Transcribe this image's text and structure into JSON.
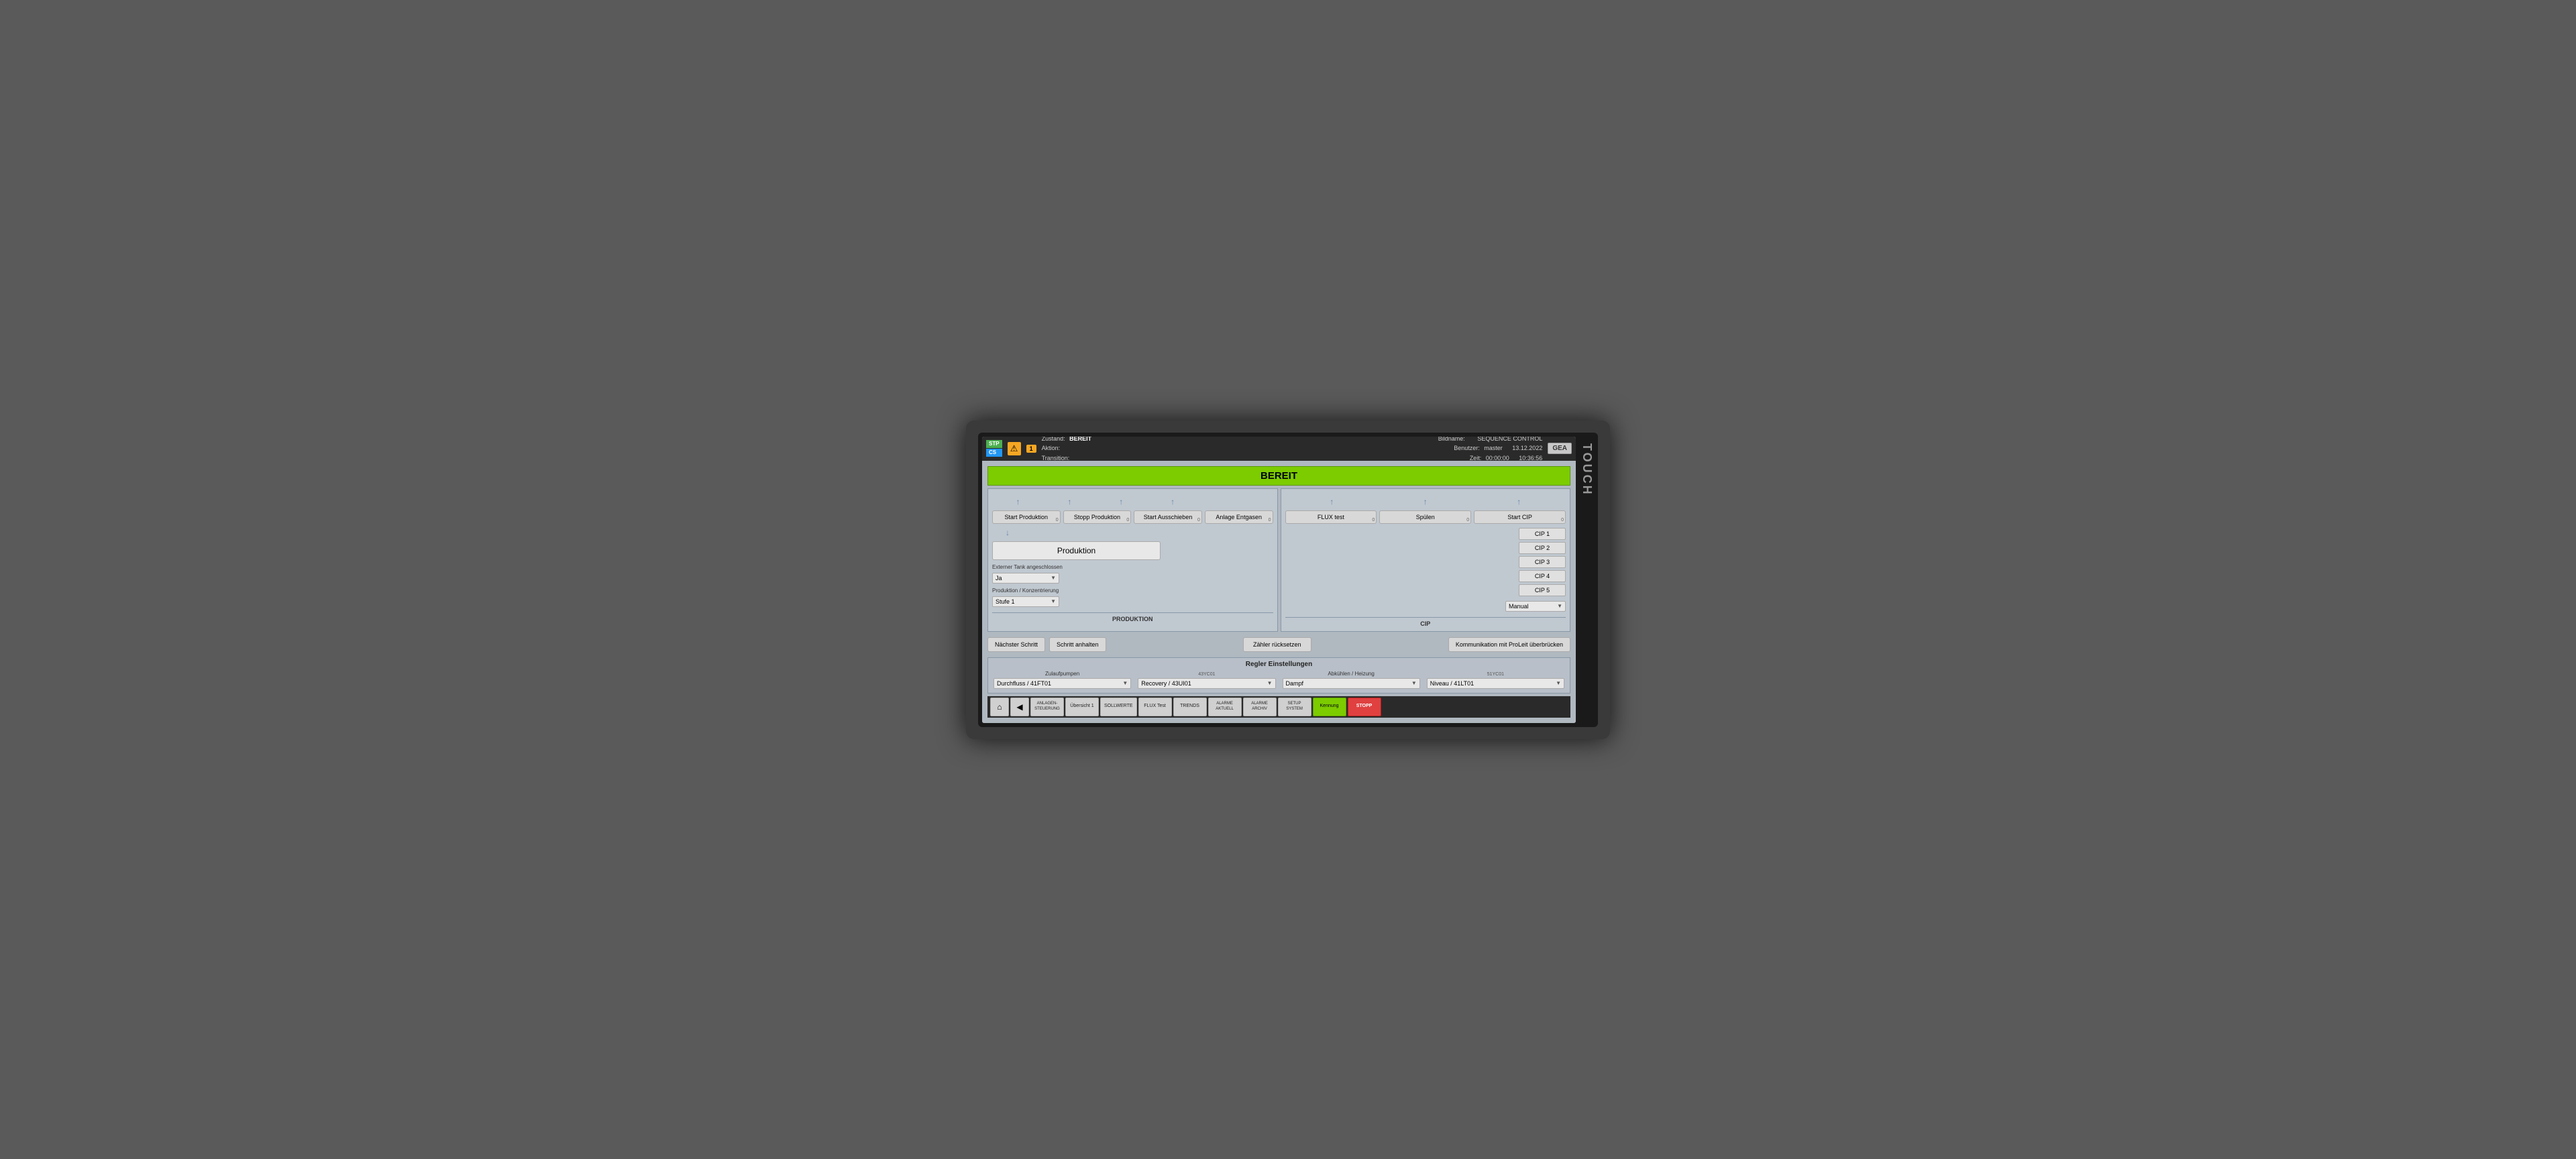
{
  "topbar": {
    "stp": "STP",
    "cs": "CS",
    "warn_num": "1",
    "zustand_label": "Zustand:",
    "zustand_value": "BEREIT",
    "aktion_label": "Aktion:",
    "aktion_value": "",
    "transition_label": "Transition:",
    "transition_value": "",
    "bildname_label": "Bildname:",
    "bildname_value": "",
    "benutzer_label": "Benutzer:",
    "benutzer_value": "master",
    "zeit_label": "Zeit:",
    "zeit_value": "00:00:00",
    "seq_label": "SEQUENCE CONTROL",
    "date_value": "13.12.2022",
    "time_display": "10:36:56",
    "gea": "GEA"
  },
  "status": {
    "text": "BEREIT",
    "color": "#7ccc00"
  },
  "produktion_panel": {
    "label": "PRODUKTION",
    "buttons": [
      {
        "label": "Start Produktion",
        "badge": "0"
      },
      {
        "label": "Stopp Produktion",
        "badge": "0"
      },
      {
        "label": "Start Ausschieben",
        "badge": "0"
      },
      {
        "label": "Anlage Entgasen",
        "badge": "0"
      }
    ],
    "produktion_box": "Produktion",
    "ext_tank_label": "Externer Tank angeschlossen",
    "ext_tank_value": "Ja",
    "prod_konz_label": "Produktion / Konzentrierung",
    "prod_konz_value": "Stufe 1"
  },
  "cip_panel": {
    "label": "CIP",
    "buttons": [
      {
        "label": "FLUX test",
        "badge": "0"
      },
      {
        "label": "Spülen",
        "badge": "0"
      },
      {
        "label": "Start CIP",
        "badge": "0"
      }
    ],
    "cip_options": [
      "CIP 1",
      "CIP 2",
      "CIP 3",
      "CIP 4",
      "CIP 5"
    ],
    "manual_value": "Manual"
  },
  "middle": {
    "naechster_schritt": "Nächster Schritt",
    "schritt_anhalten": "Schritt anhalten",
    "zaehler_ruecksetzen": "Zähler rücksetzen",
    "kommunikation": "Kommunikation mit ProLeit überbrücken"
  },
  "regler": {
    "title": "Regler Einstellungen",
    "zulaufpumpen_label": "Zulaufpumpen",
    "zulaufpumpen_value": "Durchfluss / 41FT01",
    "43yc01_label": "43YC01",
    "43yc01_value": "Recovery / 43UI01",
    "abkuehlung_label": "Abkühlen / Heizung",
    "abkuehlung_value": "Dampf",
    "51yc01_label": "51YC01",
    "51yc01_value": "Niveau / 41LT01"
  },
  "bottomnav": {
    "back_icon": "◀",
    "home_icon": "⌂",
    "items": [
      {
        "label": "ANLAGEN-\nSTEUERUNG",
        "active": false
      },
      {
        "label": "Übersicht 1",
        "active": false
      },
      {
        "label": "SOLLWERTE",
        "active": false
      },
      {
        "label": "FLUX Test",
        "active": false
      },
      {
        "label": "TRENDS",
        "active": false
      },
      {
        "label": "ALARME\nAKTUELL",
        "active": false
      },
      {
        "label": "ALARME\nARCHIV",
        "active": false
      },
      {
        "label": "SETUP\nSYSTEM",
        "active": false
      },
      {
        "label": "Kennung",
        "active": true
      },
      {
        "label": "STOPP",
        "active": false,
        "red": true
      }
    ]
  },
  "touch_label": "TOUCH"
}
